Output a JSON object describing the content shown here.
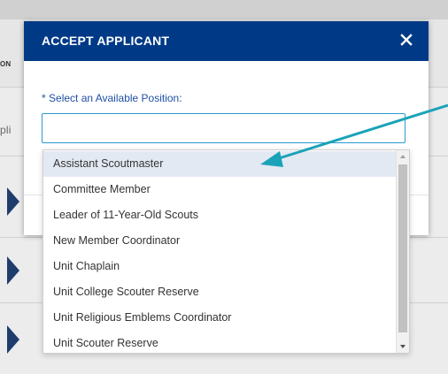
{
  "background": {
    "left_label_top": "ON",
    "left_label_mid": "pli"
  },
  "modal": {
    "title": "ACCEPT APPLICANT",
    "close_icon": "close-icon",
    "field": {
      "required_mark": "*",
      "label": "Select an Available Position:",
      "value": ""
    }
  },
  "dropdown": {
    "highlighted_index": 0,
    "options": [
      {
        "label": "Assistant Scoutmaster"
      },
      {
        "label": "Committee Member"
      },
      {
        "label": "Leader of 11-Year-Old Scouts"
      },
      {
        "label": "New Member Coordinator"
      },
      {
        "label": "Unit Chaplain"
      },
      {
        "label": "Unit College Scouter Reserve"
      },
      {
        "label": "Unit Religious Emblems Coordinator"
      },
      {
        "label": "Unit Scouter Reserve"
      }
    ]
  },
  "colors": {
    "header": "#003a87",
    "label": "#1f4fa5",
    "select_border": "#2a9bd1",
    "highlight": "#e3e9f3",
    "annotation_arrow": "#1aa3b8"
  }
}
